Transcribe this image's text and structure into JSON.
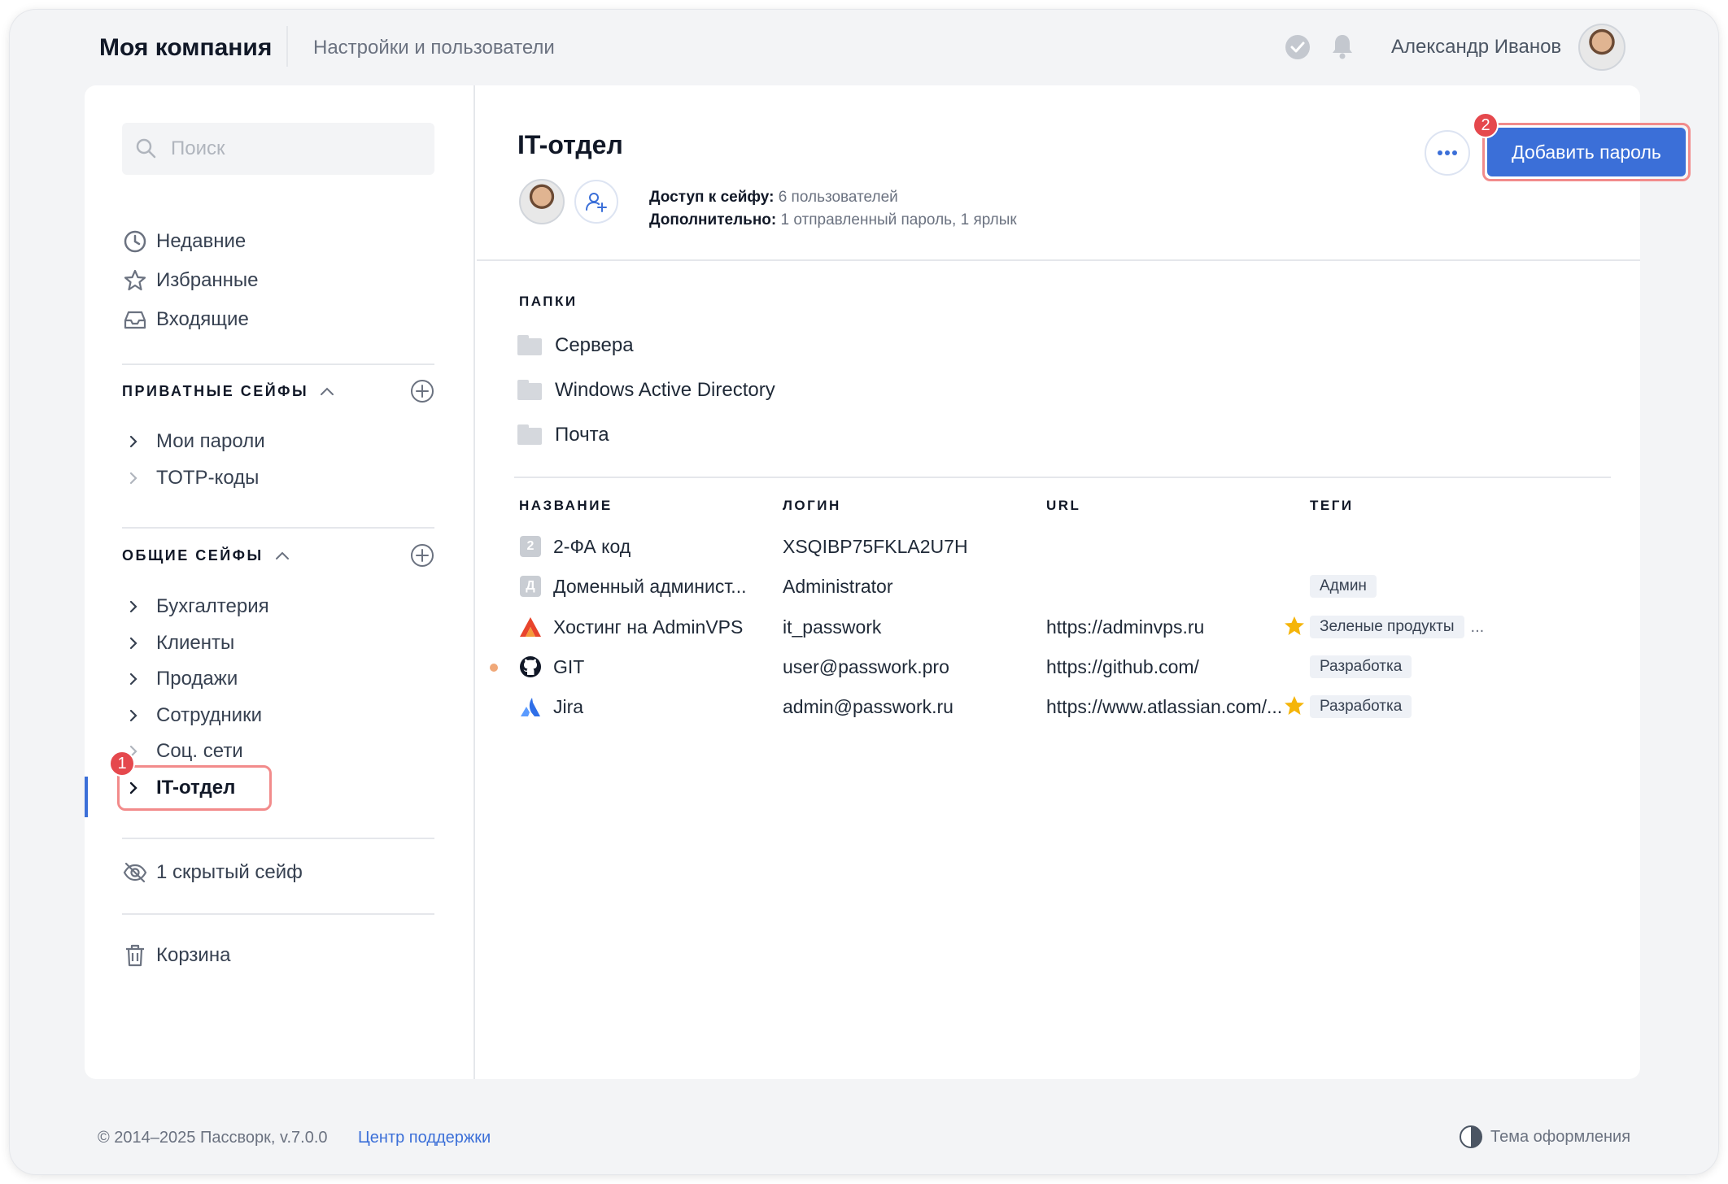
{
  "header": {
    "company": "Моя компания",
    "section": "Настройки и пользователи",
    "user_name": "Александр Иванов"
  },
  "sidebar": {
    "search_placeholder": "Поиск",
    "nav": [
      {
        "label": "Недавние",
        "icon": "clock-icon"
      },
      {
        "label": "Избранные",
        "icon": "star-icon"
      },
      {
        "label": "Входящие",
        "icon": "inbox-icon"
      }
    ],
    "private_title": "ПРИВАТНЫЕ СЕЙФЫ",
    "private_vaults": [
      "Мои пароли",
      "TOTP-коды"
    ],
    "shared_title": "ОБЩИЕ СЕЙФЫ",
    "shared_vaults": [
      "Бухгалтерия",
      "Клиенты",
      "Продажи",
      "Сотрудники",
      "Соц. сети",
      "IT-отдел"
    ],
    "hidden_vaults": "1 скрытый сейф",
    "trash": "Корзина",
    "callout_1": "1"
  },
  "vault": {
    "title": "IT-отдел",
    "access_label": "Доступ к сейфу:",
    "access_value": "6 пользователей",
    "extra_label": "Дополнительно:",
    "extra_value": "1 отправленный пароль, 1 ярлык",
    "more_label": "···",
    "add_button": "Добавить пароль",
    "callout_2": "2"
  },
  "folders": {
    "label": "ПАПКИ",
    "items": [
      "Сервера",
      "Windows Active Directory",
      "Почта"
    ]
  },
  "table": {
    "headers": [
      "НАЗВАНИЕ",
      "ЛОГИН",
      "URL",
      "ТЕГИ"
    ],
    "rows": [
      {
        "icon": "letter",
        "letter": "2",
        "name": "2-ФА код",
        "login": "XSQIBP75FKLA2U7H",
        "url": "",
        "tag": "",
        "more": "",
        "starred": false,
        "dot": false
      },
      {
        "icon": "letter",
        "letter": "Д",
        "name": "Доменный админист...",
        "login": "Administrator",
        "url": "",
        "tag": "Админ",
        "more": "",
        "starred": false,
        "dot": false
      },
      {
        "icon": "adminvps-icon",
        "letter": "",
        "name": "Хостинг на AdminVPS",
        "login": "it_passwork",
        "url": "https://adminvps.ru",
        "tag": "Зеленые продукты",
        "more": "...",
        "starred": true,
        "dot": false
      },
      {
        "icon": "github-icon",
        "letter": "",
        "name": "GIT",
        "login": "user@passwork.pro",
        "url": "https://github.com/",
        "tag": "Разработка",
        "more": "",
        "starred": false,
        "dot": true
      },
      {
        "icon": "atlassian-icon",
        "letter": "",
        "name": "Jira",
        "login": "admin@passwork.ru",
        "url": "https://www.atlassian.com/...",
        "tag": "Разработка",
        "more": "",
        "starred": true,
        "dot": false
      }
    ]
  },
  "footer": {
    "copyright": "© 2014–2025 Пассворк, v.7.0.0",
    "support": "Центр поддержки",
    "theme": "Тема оформления"
  },
  "colors": {
    "accent": "#3b6fd8",
    "callout": "#e5484d",
    "highlight_border": "#f28b8b",
    "star": "#f5b50a"
  }
}
